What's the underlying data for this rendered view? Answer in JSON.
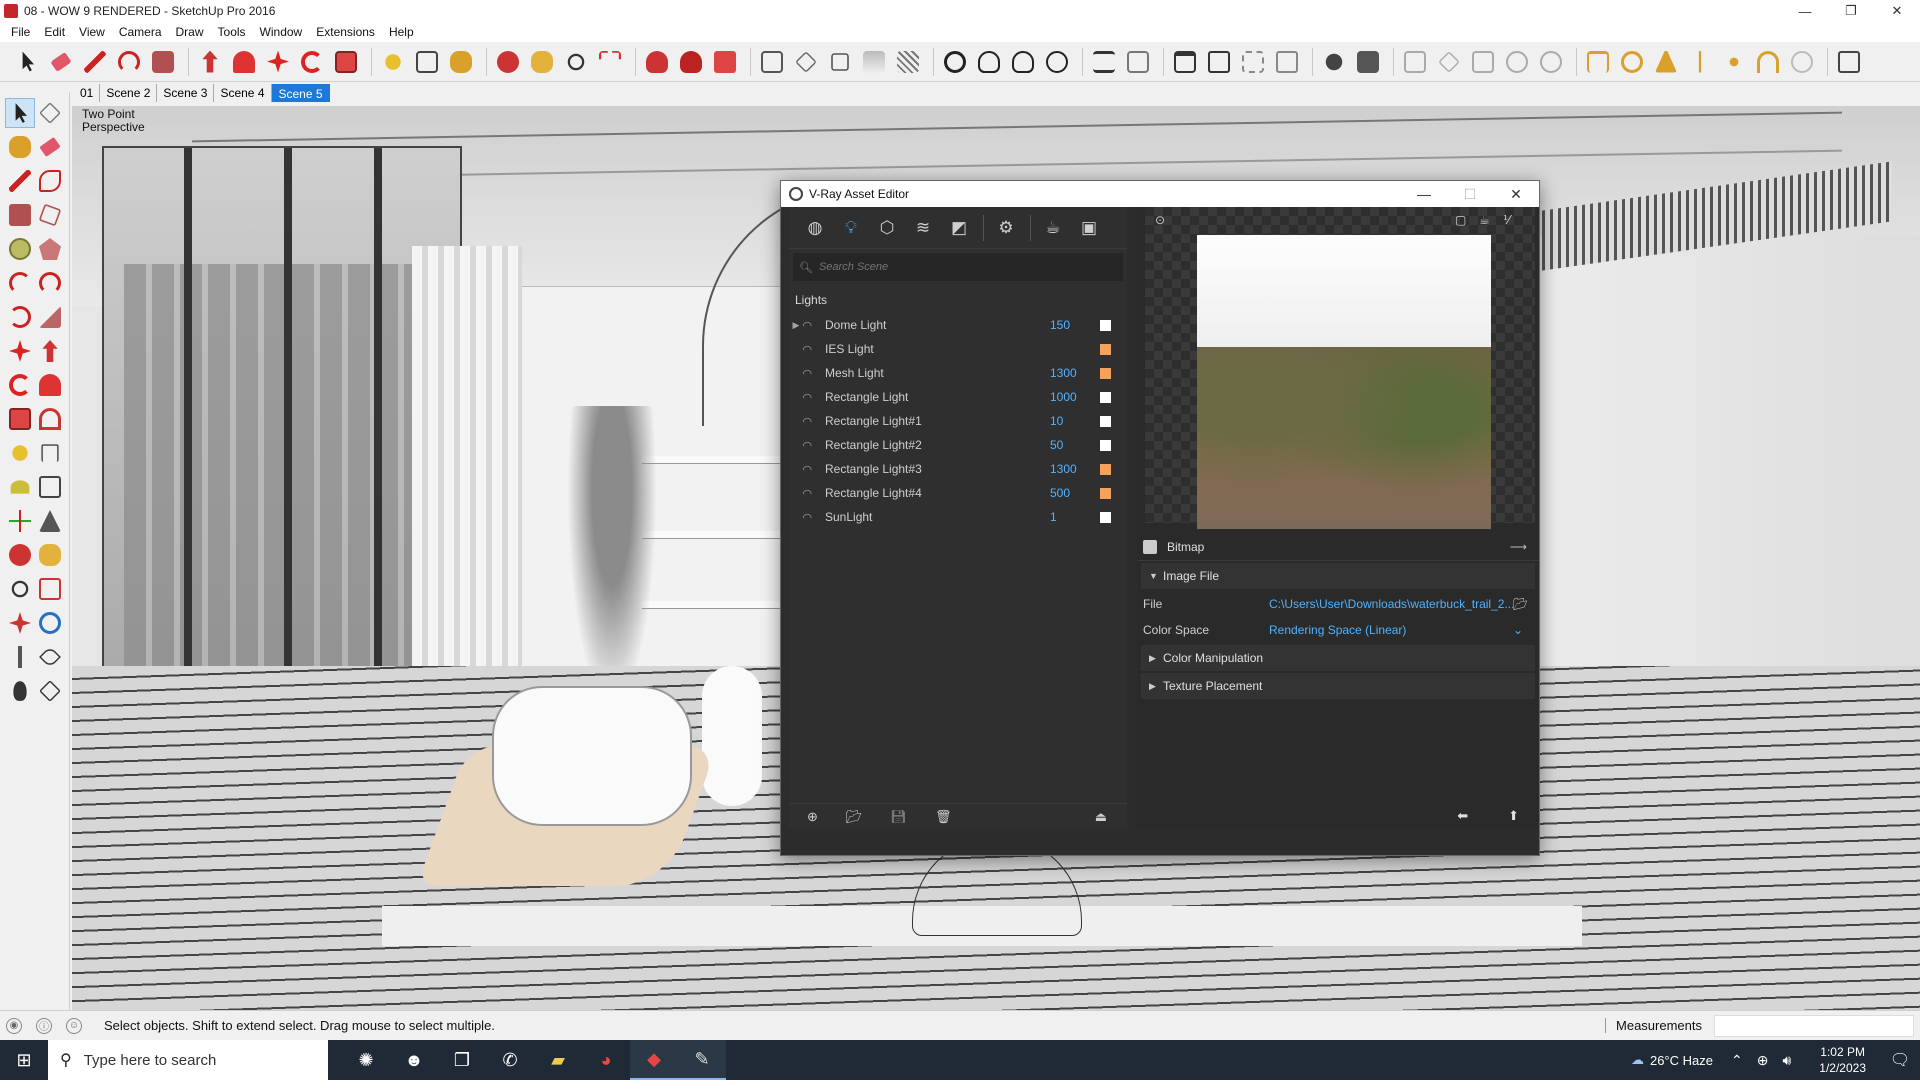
{
  "window": {
    "title": "08 - WOW 9 RENDERED - SketchUp Pro 2016",
    "minimize": "—",
    "maximize": "❐",
    "close": "✕"
  },
  "menu": [
    "File",
    "Edit",
    "View",
    "Camera",
    "Draw",
    "Tools",
    "Window",
    "Extensions",
    "Help"
  ],
  "scenes": {
    "tabs": [
      "01",
      "Scene 2",
      "Scene 3",
      "Scene 4",
      "Scene 5"
    ],
    "active": "Scene 5"
  },
  "viewport": {
    "camera_line1": "Two Point",
    "camera_line2": "Perspective"
  },
  "vray": {
    "title": "V-Ray Asset Editor",
    "minimize": "—",
    "maximize": "☐",
    "close": "✕",
    "search_placeholder": "Search Scene",
    "section": "Lights",
    "lights": [
      {
        "name": "Dome Light",
        "value": "150",
        "swatch": "#ffffff",
        "expandable": true
      },
      {
        "name": "IES Light",
        "value": "",
        "swatch": "#f4a15d",
        "expandable": false
      },
      {
        "name": "Mesh Light",
        "value": "1300",
        "swatch": "#f4a15d",
        "expandable": false
      },
      {
        "name": "Rectangle Light",
        "value": "1000",
        "swatch": "#ffffff",
        "expandable": false
      },
      {
        "name": "Rectangle Light#1",
        "value": "10",
        "swatch": "#ffffff",
        "expandable": false
      },
      {
        "name": "Rectangle Light#2",
        "value": "50",
        "swatch": "#ffffff",
        "expandable": false
      },
      {
        "name": "Rectangle Light#3",
        "value": "1300",
        "swatch": "#f4a15d",
        "expandable": false
      },
      {
        "name": "Rectangle Light#4",
        "value": "500",
        "swatch": "#f4a15d",
        "expandable": false
      },
      {
        "name": "SunLight",
        "value": "1",
        "swatch": "#ffffff",
        "expandable": false
      }
    ],
    "props": {
      "header": "Bitmap",
      "section_image": "Image File",
      "file_label": "File",
      "file_value": "C:\\Users\\User\\Downloads\\waterbuck_trail_2...",
      "colorspace_label": "Color Space",
      "colorspace_value": "Rendering Space (Linear)",
      "section_color": "Color Manipulation",
      "section_texture": "Texture Placement"
    },
    "accent": "#4fb3ff"
  },
  "status": {
    "hint": "Select objects. Shift to extend select. Drag mouse to select multiple.",
    "measurements_label": "Measurements"
  },
  "taskbar": {
    "search_placeholder": "Type here to search",
    "weather": "26°C  Haze",
    "time": "1:02 PM",
    "date": "1/2/2023"
  }
}
